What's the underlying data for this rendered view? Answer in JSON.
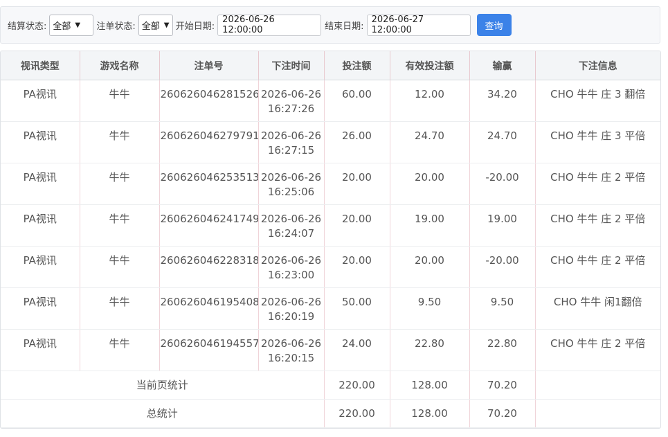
{
  "filters": {
    "settle_label": "结算状态:",
    "settle_value": "全部",
    "order_label": "注单状态:",
    "order_value": "全部",
    "start_label": "开始日期:",
    "start_value": "2026-06-26 12:00:00",
    "end_label": "结束日期:",
    "end_value": "2026-06-27 12:00:00",
    "query_label": "查询"
  },
  "table": {
    "headers": [
      "视讯类型",
      "游戏名称",
      "注单号",
      "下注时间",
      "投注额",
      "有效投注额",
      "输赢",
      "下注信息"
    ],
    "rows": [
      {
        "type": "PA视讯",
        "game": "牛牛",
        "id": "260626046281526",
        "date": "2026-06-26",
        "time": "16:27:26",
        "bet": "60.00",
        "valid": "12.00",
        "win": "34.20",
        "info": "CHO 牛牛 庄 3 翻倍"
      },
      {
        "type": "PA视讯",
        "game": "牛牛",
        "id": "260626046279791",
        "date": "2026-06-26",
        "time": "16:27:15",
        "bet": "26.00",
        "valid": "24.70",
        "win": "24.70",
        "info": "CHO 牛牛 庄 3 平倍"
      },
      {
        "type": "PA视讯",
        "game": "牛牛",
        "id": "260626046253513",
        "date": "2026-06-26",
        "time": "16:25:06",
        "bet": "20.00",
        "valid": "20.00",
        "win": "-20.00",
        "info": "CHO 牛牛 庄 2 平倍"
      },
      {
        "type": "PA视讯",
        "game": "牛牛",
        "id": "260626046241749",
        "date": "2026-06-26",
        "time": "16:24:07",
        "bet": "20.00",
        "valid": "19.00",
        "win": "19.00",
        "info": "CHO 牛牛 庄 2 平倍"
      },
      {
        "type": "PA视讯",
        "game": "牛牛",
        "id": "260626046228318",
        "date": "2026-06-26",
        "time": "16:23:00",
        "bet": "20.00",
        "valid": "20.00",
        "win": "-20.00",
        "info": "CHO 牛牛 庄 2 平倍"
      },
      {
        "type": "PA视讯",
        "game": "牛牛",
        "id": "260626046195408",
        "date": "2026-06-26",
        "time": "16:20:19",
        "bet": "50.00",
        "valid": "9.50",
        "win": "9.50",
        "info": "CHO 牛牛 闲1翻倍"
      },
      {
        "type": "PA视讯",
        "game": "牛牛",
        "id": "260626046194557",
        "date": "2026-06-26",
        "time": "16:20:15",
        "bet": "24.00",
        "valid": "22.80",
        "win": "22.80",
        "info": "CHO 牛牛 庄 2 平倍"
      }
    ],
    "page_total": {
      "label": "当前页统计",
      "bet": "220.00",
      "valid": "128.00",
      "win": "70.20"
    },
    "grand_total": {
      "label": "总统计",
      "bet": "220.00",
      "valid": "128.00",
      "win": "70.20"
    }
  }
}
